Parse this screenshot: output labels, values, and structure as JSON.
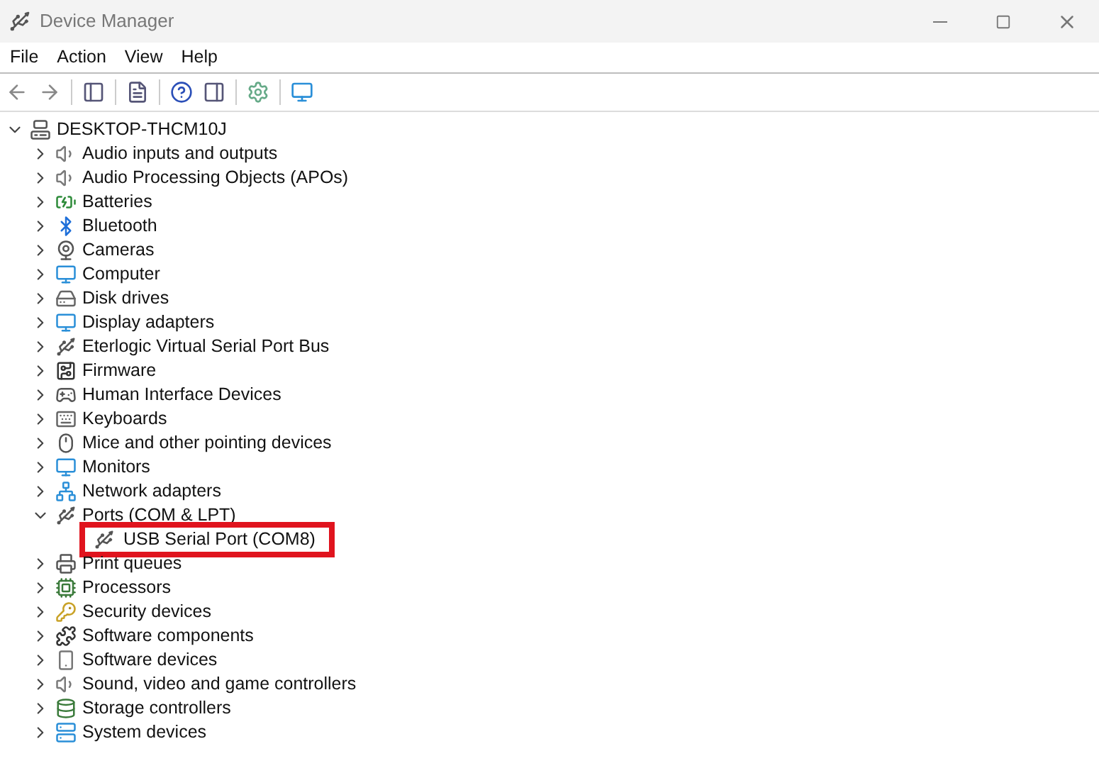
{
  "window": {
    "title": "Device Manager"
  },
  "menu": [
    "File",
    "Action",
    "View",
    "Help"
  ],
  "tree": {
    "label": "DESKTOP-THCM10J",
    "expanded": true,
    "children": [
      {
        "label": "Audio inputs and outputs",
        "expanded": false
      },
      {
        "label": "Audio Processing Objects (APOs)",
        "expanded": false
      },
      {
        "label": "Batteries",
        "expanded": false
      },
      {
        "label": "Bluetooth",
        "expanded": false
      },
      {
        "label": "Cameras",
        "expanded": false
      },
      {
        "label": "Computer",
        "expanded": false
      },
      {
        "label": "Disk drives",
        "expanded": false
      },
      {
        "label": "Display adapters",
        "expanded": false
      },
      {
        "label": "Eterlogic Virtual Serial Port Bus",
        "expanded": false
      },
      {
        "label": "Firmware",
        "expanded": false
      },
      {
        "label": "Human Interface Devices",
        "expanded": false
      },
      {
        "label": "Keyboards",
        "expanded": false
      },
      {
        "label": "Mice and other pointing devices",
        "expanded": false
      },
      {
        "label": "Monitors",
        "expanded": false
      },
      {
        "label": "Network adapters",
        "expanded": false
      },
      {
        "label": "Ports (COM & LPT)",
        "expanded": true,
        "children": [
          {
            "label": "USB Serial Port (COM8)",
            "highlighted": true
          }
        ]
      },
      {
        "label": "Print queues",
        "expanded": false
      },
      {
        "label": "Processors",
        "expanded": false
      },
      {
        "label": "Security devices",
        "expanded": false
      },
      {
        "label": "Software components",
        "expanded": false
      },
      {
        "label": "Software devices",
        "expanded": false
      },
      {
        "label": "Sound, video and game controllers",
        "expanded": false
      },
      {
        "label": "Storage controllers",
        "expanded": false
      },
      {
        "label": "System devices",
        "expanded": false
      }
    ]
  }
}
